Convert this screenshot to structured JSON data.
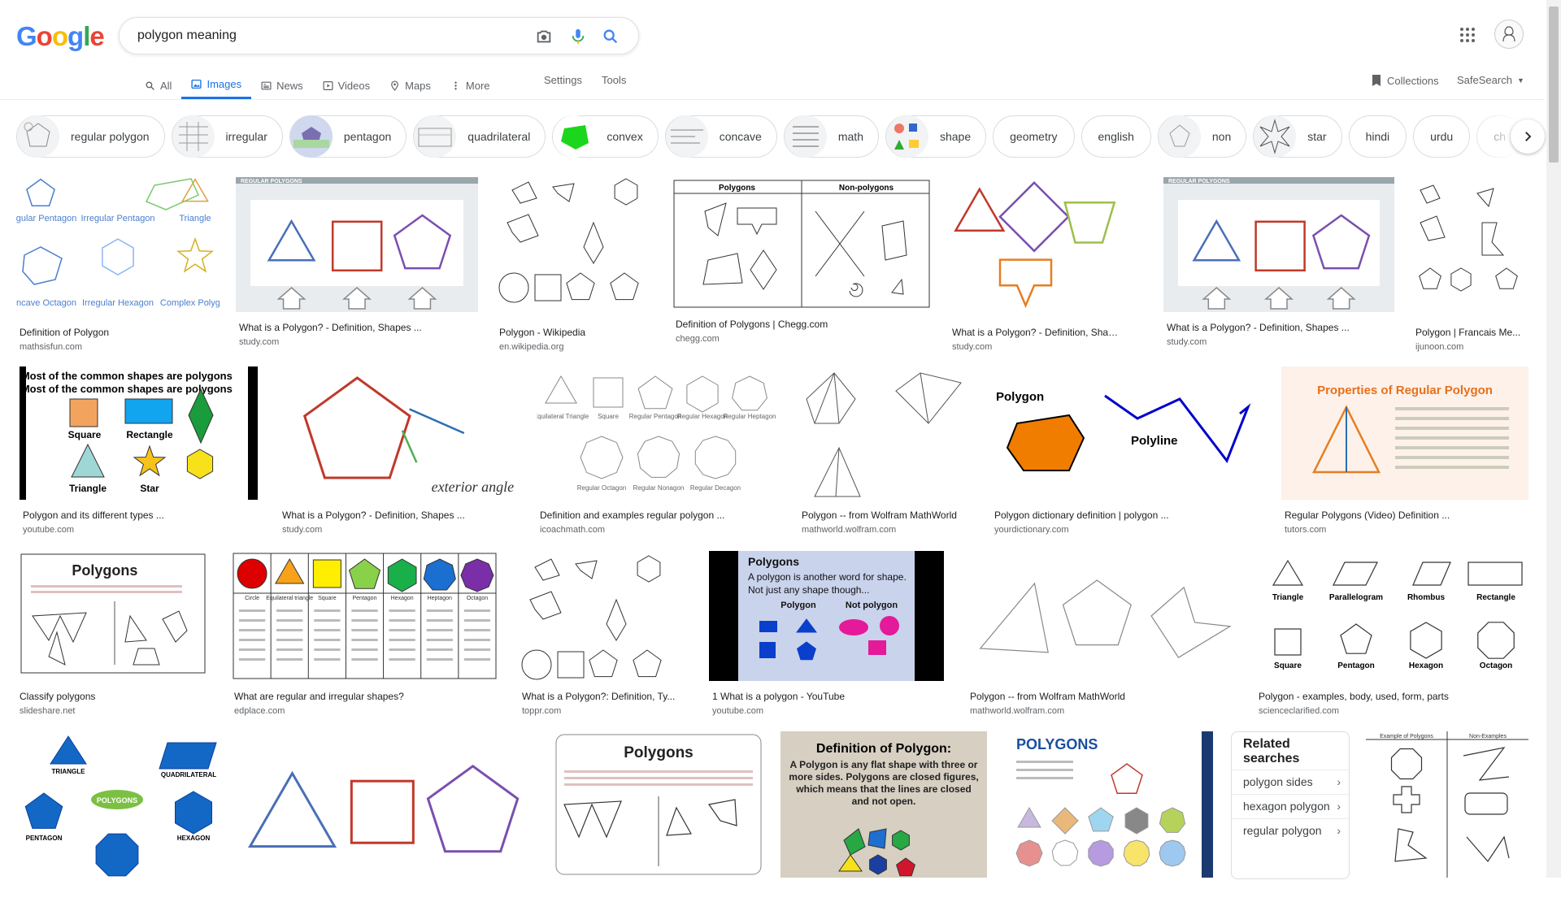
{
  "logo": {
    "letters": [
      "G",
      "o",
      "o",
      "g",
      "l",
      "e"
    ],
    "colors": [
      "#4285f4",
      "#ea4335",
      "#fbbc05",
      "#4285f4",
      "#34a853",
      "#ea4335"
    ]
  },
  "search": {
    "query": "polygon meaning"
  },
  "tabs": [
    {
      "label": "All",
      "icon": "search-icon"
    },
    {
      "label": "Images",
      "icon": "image-icon",
      "active": true
    },
    {
      "label": "News",
      "icon": "news-icon"
    },
    {
      "label": "Videos",
      "icon": "video-icon"
    },
    {
      "label": "Maps",
      "icon": "map-pin-icon"
    },
    {
      "label": "More",
      "icon": "more-vert-icon"
    }
  ],
  "settings_label": "Settings",
  "tools_label": "Tools",
  "collections_label": "Collections",
  "safesearch_label": "SafeSearch",
  "chips": [
    "regular polygon",
    "irregular",
    "pentagon",
    "quadrilateral",
    "convex",
    "concave",
    "math",
    "shape",
    "geometry",
    "english",
    "non",
    "star",
    "hindi",
    "urdu",
    "ch"
  ],
  "results": [
    {
      "title": "Definition of Polygon",
      "source": "mathsisfun.com",
      "thumb_text": [
        "Regular Pentagon",
        "Irregular Pentagon",
        "Triangle",
        "Concave Octagon",
        "Irregular Hexagon",
        "Complex Polygon"
      ]
    },
    {
      "title": "What is a Polygon? - Definition, Shapes ...",
      "source": "study.com",
      "thumb_text": [
        "REGULAR POLYGONS"
      ]
    },
    {
      "title": "Polygon - Wikipedia",
      "source": "en.wikipedia.org"
    },
    {
      "title": "Definition of Polygons | Chegg.com",
      "source": "chegg.com",
      "thumb_text": [
        "Polygons",
        "Non-polygons"
      ]
    },
    {
      "title": "What is a Polygon? - Definition, Shapes ...",
      "source": "study.com"
    },
    {
      "title": "What is a Polygon? - Definition, Shapes ...",
      "source": "study.com",
      "thumb_text": [
        "REGULAR POLYGONS"
      ]
    },
    {
      "title": "Polygon | Francais Me...",
      "source": "ijunoon.com"
    },
    {
      "title": "Polygon and its different types ...",
      "source": "youtube.com",
      "thumb_text": [
        "Most of the common shapes are polygons",
        "Square",
        "Rectangle",
        "Triangle",
        "Star"
      ]
    },
    {
      "title": "What is a Polygon? - Definition, Shapes ...",
      "source": "study.com",
      "thumb_text": [
        "exterior angle"
      ]
    },
    {
      "title": "Definition and examples regular polygon ...",
      "source": "icoachmath.com",
      "thumb_text": [
        "Equilateral Triangle",
        "Square",
        "Regular Pentagon",
        "Regular Hexagon",
        "Regular Heptagon",
        "Regular Octagon",
        "Regular Nonagon",
        "Regular Decagon"
      ]
    },
    {
      "title": "Polygon -- from Wolfram MathWorld",
      "source": "mathworld.wolfram.com"
    },
    {
      "title": "Polygon dictionary definition | polygon ...",
      "source": "yourdictionary.com",
      "thumb_text": [
        "Polygon",
        "Polyline"
      ]
    },
    {
      "title": "Regular Polygons (Video) Definition ...",
      "source": "tutors.com",
      "thumb_text": [
        "Properties of Regular Polygon"
      ]
    },
    {
      "title": "Classify polygons",
      "source": "slideshare.net",
      "thumb_text": [
        "Polygons"
      ]
    },
    {
      "title": "What are regular and irregular shapes?",
      "source": "edplace.com",
      "thumb_text": [
        "Circle",
        "Equilateral triangle",
        "Square",
        "Pentagon",
        "Hexagon",
        "Heptagon",
        "Octagon"
      ]
    },
    {
      "title": "What is a Polygon?: Definition, Ty...",
      "source": "toppr.com"
    },
    {
      "title": "1 What is a polygon - YouTube",
      "source": "youtube.com",
      "thumb_text": [
        "Polygons",
        "A polygon is another word for shape.",
        "Not just any shape though...",
        "Polygon",
        "Not polygon"
      ]
    },
    {
      "title": "Polygon -- from Wolfram MathWorld",
      "source": "mathworld.wolfram.com"
    },
    {
      "title": "Polygon - examples, body, used, form, parts",
      "source": "scienceclarified.com",
      "thumb_text": [
        "Triangle",
        "Parallelogram",
        "Rhombus",
        "Rectangle",
        "Square",
        "Pentagon",
        "Hexagon",
        "Octagon"
      ]
    },
    {
      "title": "",
      "source": "",
      "thumb_text": [
        "TRIANGLE",
        "QUADRILATERAL",
        "POLYGONS",
        "PENTAGON",
        "HEXAGON"
      ]
    },
    {
      "title": "",
      "source": ""
    },
    {
      "title": "",
      "source": "",
      "thumb_text": [
        "Polygons"
      ]
    },
    {
      "title": "",
      "source": "",
      "thumb_text": [
        "Definition of Polygon:",
        "A Polygon is any flat shape with three or more sides. Polygons are closed figures, which means that the lines are closed and not open."
      ]
    },
    {
      "title": "",
      "source": "",
      "thumb_text": [
        "POLYGONS"
      ]
    },
    {
      "title": "",
      "source": "",
      "thumb_text": [
        "Example of Polygons",
        "Non-Examples"
      ]
    }
  ],
  "related": {
    "heading": "Related searches",
    "items": [
      "polygon sides",
      "hexagon polygon",
      "regular polygon"
    ]
  }
}
